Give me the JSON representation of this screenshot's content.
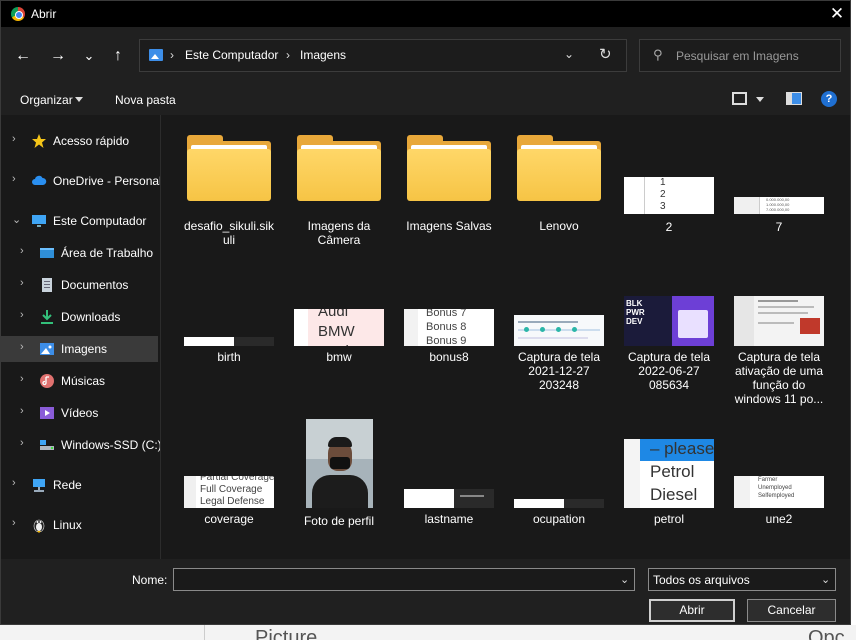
{
  "window": {
    "title": "Abrir",
    "close_glyph": "✕"
  },
  "nav": {
    "back_glyph": "←",
    "forward_glyph": "→",
    "recent_glyph": "⌄",
    "up_glyph": "↑",
    "breadcrumb": [
      "Este Computador",
      "Imagens"
    ],
    "separator": "›",
    "dropdown_glyph": "⌄",
    "refresh_glyph": "↻",
    "search_placeholder": "Pesquisar em Imagens",
    "search_icon": "⚲"
  },
  "toolbar": {
    "organize_label": "Organizar",
    "new_folder_label": "Nova pasta",
    "help_label": "?"
  },
  "sidebar": {
    "items": [
      {
        "label": "Acesso rápido",
        "icon": "star-icon",
        "chevron": "›"
      },
      {
        "label": "OneDrive - Personal",
        "icon": "cloud-icon",
        "chevron": "›"
      },
      {
        "label": "Este Computador",
        "icon": "computer-icon",
        "chevron": "⌄"
      },
      {
        "label": "Área de Trabalho",
        "icon": "desktop-icon",
        "chevron": "›"
      },
      {
        "label": "Documentos",
        "icon": "documents-icon",
        "chevron": "›"
      },
      {
        "label": "Downloads",
        "icon": "download-icon",
        "chevron": "›"
      },
      {
        "label": "Imagens",
        "icon": "pictures-icon",
        "chevron": "›",
        "selected": true
      },
      {
        "label": "Músicas",
        "icon": "music-icon",
        "chevron": "›"
      },
      {
        "label": "Vídeos",
        "icon": "videos-icon",
        "chevron": "›"
      },
      {
        "label": "Windows-SSD (C:)",
        "icon": "drive-icon",
        "chevron": "›"
      },
      {
        "label": "Rede",
        "icon": "network-icon",
        "chevron": "›"
      },
      {
        "label": "Linux",
        "icon": "linux-icon",
        "chevron": "›"
      }
    ]
  },
  "files": [
    {
      "name": "desafio_sikuli.sik\nuli",
      "kind": "folder"
    },
    {
      "name": "Imagens da\nCâmera",
      "kind": "folder"
    },
    {
      "name": "Imagens Salvas",
      "kind": "folder"
    },
    {
      "name": "Lenovo",
      "kind": "folder"
    },
    {
      "name": "2",
      "kind": "image",
      "thumb_text": "1\n2\n3"
    },
    {
      "name": "7",
      "kind": "image",
      "thumb_text": "0.000.000,00\n1.000.000,00\n7.000.000,00"
    },
    {
      "name": "birth",
      "kind": "image"
    },
    {
      "name": "bmw",
      "kind": "image",
      "thumb_text": "Audi\nBMW\nFord"
    },
    {
      "name": "bonus8",
      "kind": "image",
      "thumb_text": "Bonus 7\nBonus 8\nBonus 9"
    },
    {
      "name": "Captura de tela\n2021-12-27\n203248",
      "kind": "image"
    },
    {
      "name": "Captura de tela\n2022-06-27\n085634",
      "kind": "image",
      "thumb_text": "BLK\nPWR\nDEV"
    },
    {
      "name": "Captura de tela\nativação de uma\nfunção do\nwindows 11 po...",
      "kind": "image"
    },
    {
      "name": "coverage",
      "kind": "image",
      "thumb_text": "Partial Coverage\nFull Coverage\nLegal Defense"
    },
    {
      "name": "Foto de perfil",
      "kind": "image"
    },
    {
      "name": "lastname",
      "kind": "image"
    },
    {
      "name": "ocupation",
      "kind": "image"
    },
    {
      "name": "petrol",
      "kind": "image",
      "thumb_text": "– please\nPetrol\nDiesel"
    },
    {
      "name": "une2",
      "kind": "image",
      "thumb_text": "Farmer\nUnemployed\nSelfemployed"
    }
  ],
  "footer": {
    "name_label": "Nome:",
    "name_value": "",
    "filetype_value": "Todos os arquivos",
    "open_label": "Abrir",
    "cancel_label": "Cancelar",
    "dropdown_glyph": "⌄"
  },
  "background": {
    "left_text": "Picture",
    "right_text": "Opc"
  }
}
